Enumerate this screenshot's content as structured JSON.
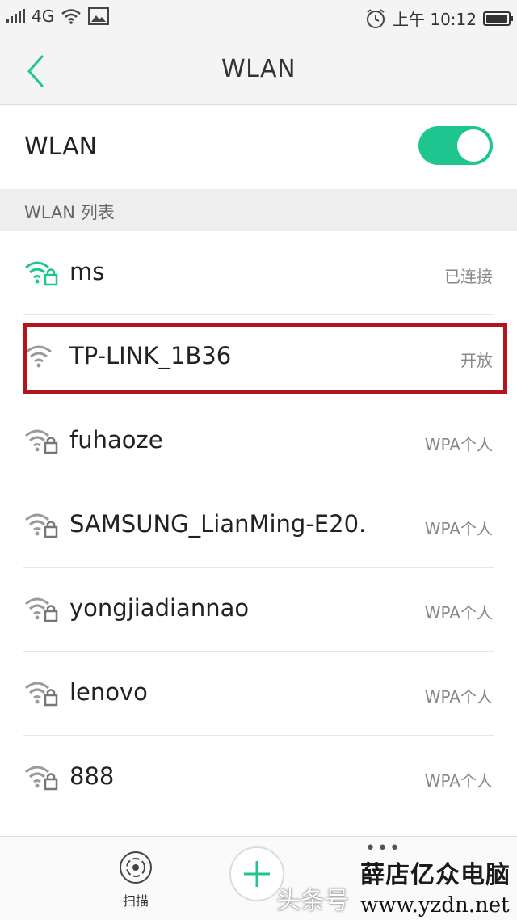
{
  "status_bar": {
    "network": "4G",
    "time": "上午 10:12"
  },
  "header": {
    "title": "WLAN"
  },
  "wlan_toggle": {
    "label": "WLAN",
    "state": "on",
    "color": "#1ec58f"
  },
  "section": {
    "title": "WLAN 列表"
  },
  "networks": [
    {
      "name": "ms",
      "status": "已连接",
      "secured": true,
      "connected": true
    },
    {
      "name": "TP-LINK_1B36",
      "status": "开放",
      "secured": false,
      "connected": false
    },
    {
      "name": "fuhaoze",
      "status": "WPA个人",
      "secured": true,
      "connected": false
    },
    {
      "name": "SAMSUNG_LianMing-E20.",
      "status": "WPA个人",
      "secured": true,
      "connected": false
    },
    {
      "name": "yongjiadiannao",
      "status": "WPA个人",
      "secured": true,
      "connected": false
    },
    {
      "name": "lenovo",
      "status": "WPA个人",
      "secured": true,
      "connected": false
    },
    {
      "name": "888",
      "status": "WPA个人",
      "secured": true,
      "connected": false
    }
  ],
  "bottom_bar": {
    "scan_label": "扫描",
    "more": "•••"
  },
  "watermark": {
    "text": "头条号",
    "brand": "薛店亿众电脑",
    "url": "www.yzdn.net"
  },
  "colors": {
    "accent": "#1ec58f",
    "highlight_border": "#b3151c"
  }
}
